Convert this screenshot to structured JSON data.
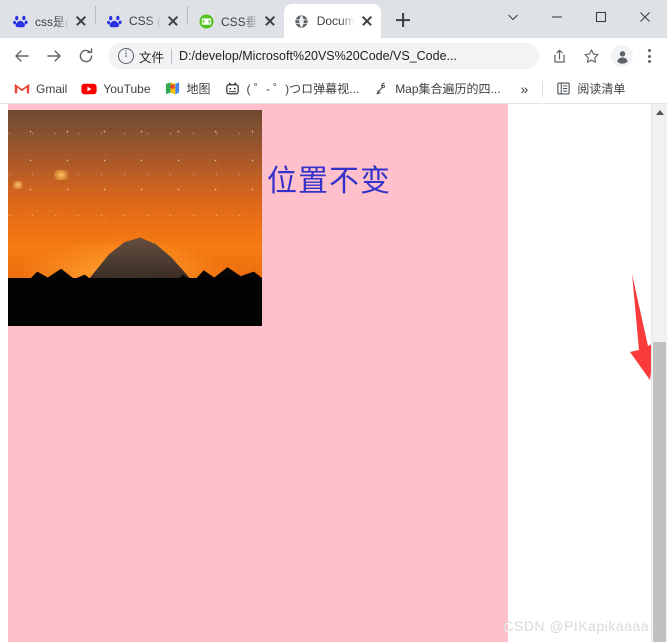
{
  "window": {
    "controls": {
      "tab_search": "tab-search",
      "minimize": "minimize",
      "maximize": "maximize",
      "close": "close"
    }
  },
  "tabstrip": {
    "new_tab_label": "+",
    "tabs": [
      {
        "title": "css是(",
        "favicon": "baidu-paw-icon",
        "active": false
      },
      {
        "title": "CSS (",
        "favicon": "baidu-paw-icon",
        "active": false
      },
      {
        "title": "CSS垂",
        "favicon": "csdn-green-icon",
        "active": false
      },
      {
        "title": "Docum",
        "favicon": "globe-icon",
        "active": true
      }
    ]
  },
  "toolbar": {
    "back": "←",
    "forward": "→",
    "reload": "C",
    "omnibox": {
      "scheme_label": "文件",
      "url": "D:/develop/Microsoft%20VS%20Code/VS_Code...",
      "info_icon": "info-circle-icon"
    },
    "share": "share-icon",
    "bookmark_star": "star-icon",
    "profile": "avatar-icon",
    "menu": "three-dot-menu-icon"
  },
  "bookmarks": {
    "items": [
      {
        "label": "Gmail",
        "icon": "gmail-icon"
      },
      {
        "label": "YouTube",
        "icon": "youtube-icon"
      },
      {
        "label": "地图",
        "icon": "maps-icon"
      },
      {
        "label": "( ゜- ゜)つロ弹幕视...",
        "icon": "bilibili-icon"
      },
      {
        "label": "Map集合遍历的四...",
        "icon": "pen-icon"
      }
    ],
    "overflow_label": "»",
    "reading_list": {
      "label": "阅读清单",
      "icon": "reading-list-icon"
    }
  },
  "page": {
    "heading_text": "位置不变",
    "heading_color": "#3333cc",
    "block_color": "#ffc0cb",
    "photo_alt": "sunset-mountain-photo",
    "watermark": "CSDN @PIKapikaaaa"
  },
  "scrollbar": {
    "up_arrow": "scroll-up-arrow",
    "thumb": "scroll-thumb"
  },
  "annotation": {
    "arrow_color": "#fb3b3b",
    "name": "red-down-arrow"
  }
}
